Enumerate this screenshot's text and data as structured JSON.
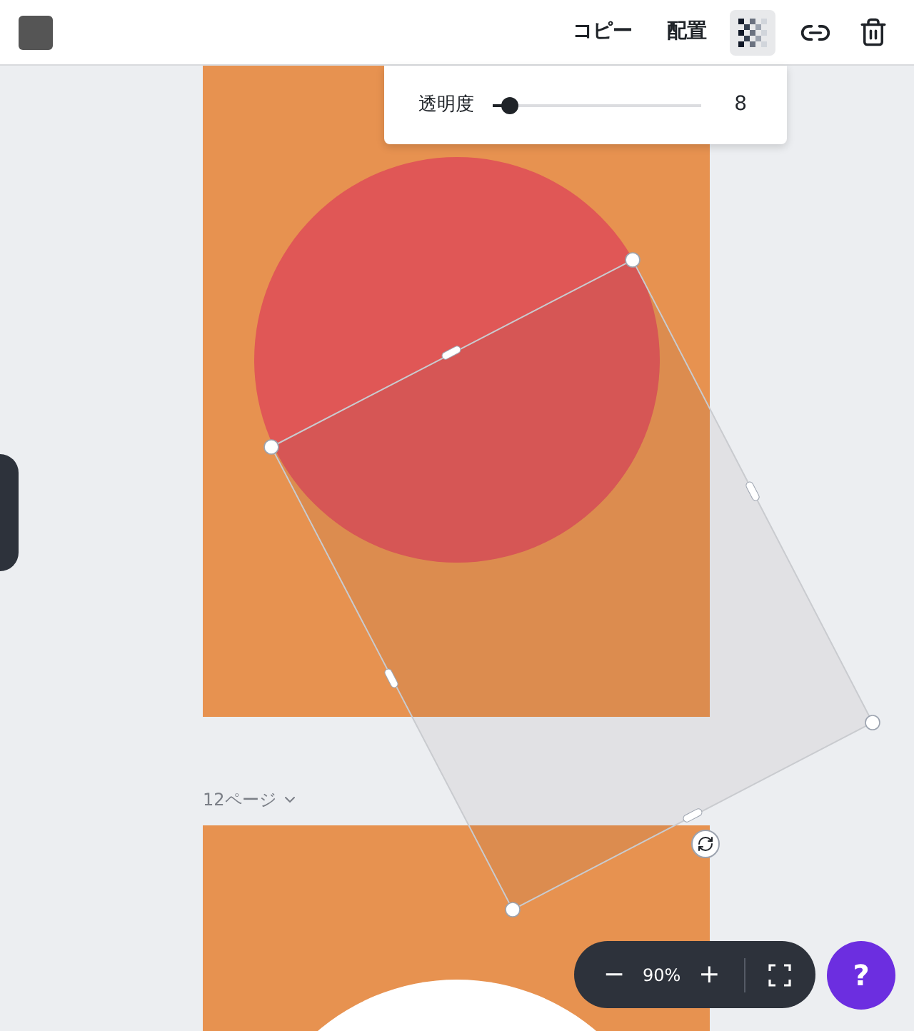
{
  "toolbar": {
    "copy_label": "コピー",
    "arrange_label": "配置",
    "transparency_active": true
  },
  "transparency_popover": {
    "label": "透明度",
    "level": 0.08,
    "value": "8"
  },
  "page_label": "12ページ",
  "zoom": {
    "zoom_out": "−",
    "value": "90%",
    "zoom_in": "+"
  },
  "help": "?"
}
